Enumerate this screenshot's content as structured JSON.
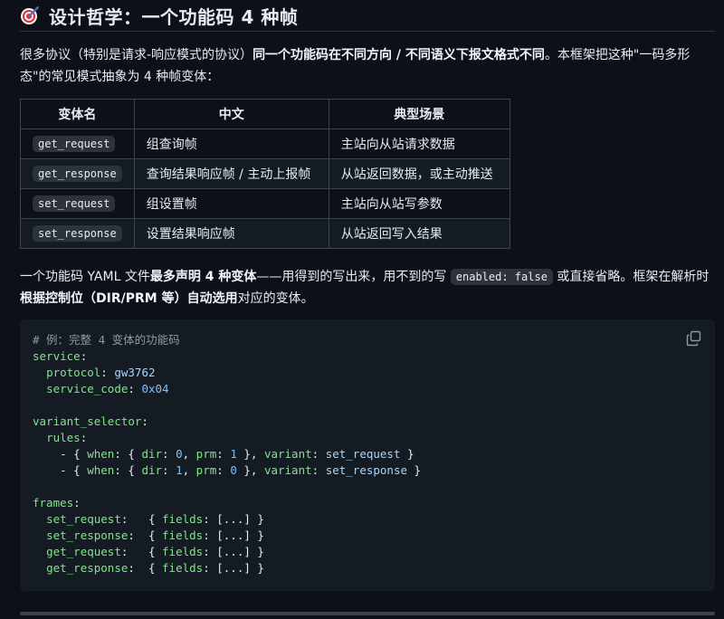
{
  "heading": {
    "icon": "target-icon",
    "title": "设计哲学：一个功能码 4 种帧"
  },
  "intro": {
    "t1": "很多协议（特别是请求-响应模式的协议）",
    "b1": "同一个功能码在不同方向 / 不同语义下报文格式不同",
    "t2": "。本框架把这种\"一码多形态\"的常见模式抽象为 4 种帧变体："
  },
  "table": {
    "headers": [
      "变体名",
      "中文",
      "典型场景"
    ],
    "rows": [
      {
        "name": "get_request",
        "cn": "组查询帧",
        "scene": "主站向从站请求数据"
      },
      {
        "name": "get_response",
        "cn": "查询结果响应帧 / 主动上报帧",
        "scene": "从站返回数据，或主动推送"
      },
      {
        "name": "set_request",
        "cn": "组设置帧",
        "scene": "主站向从站写参数"
      },
      {
        "name": "set_response",
        "cn": "设置结果响应帧",
        "scene": "从站返回写入结果"
      }
    ]
  },
  "para2": {
    "t1": "一个功能码 YAML 文件",
    "b1": "最多声明 4 种变体",
    "t2": "——用得到的写出来，用不到的写 ",
    "code": "enabled: false",
    "t3": " 或直接省略。框架在解析时",
    "b2": "根据控制位（DIR/PRM 等）自动选用",
    "t4": "对应的变体。"
  },
  "code": {
    "comment": "# 例：完整 4 变体的功能码",
    "service_key": "service",
    "protocol_key": "protocol",
    "protocol_val": "gw3762",
    "service_code_key": "service_code",
    "service_code_val": "0x04",
    "selector_key": "variant_selector",
    "rules_key": "rules",
    "rule1": {
      "dir": "0",
      "prm": "1",
      "variant": "set_request"
    },
    "rule2": {
      "dir": "1",
      "prm": "0",
      "variant": "set_response"
    },
    "frames_key": "frames",
    "frames": [
      {
        "key": "set_request",
        "pad": "   "
      },
      {
        "key": "set_response",
        "pad": "  "
      },
      {
        "key": "get_request",
        "pad": "   "
      },
      {
        "key": "get_response",
        "pad": "  "
      }
    ],
    "fields_key": "fields",
    "ellipsis": "[...]"
  }
}
